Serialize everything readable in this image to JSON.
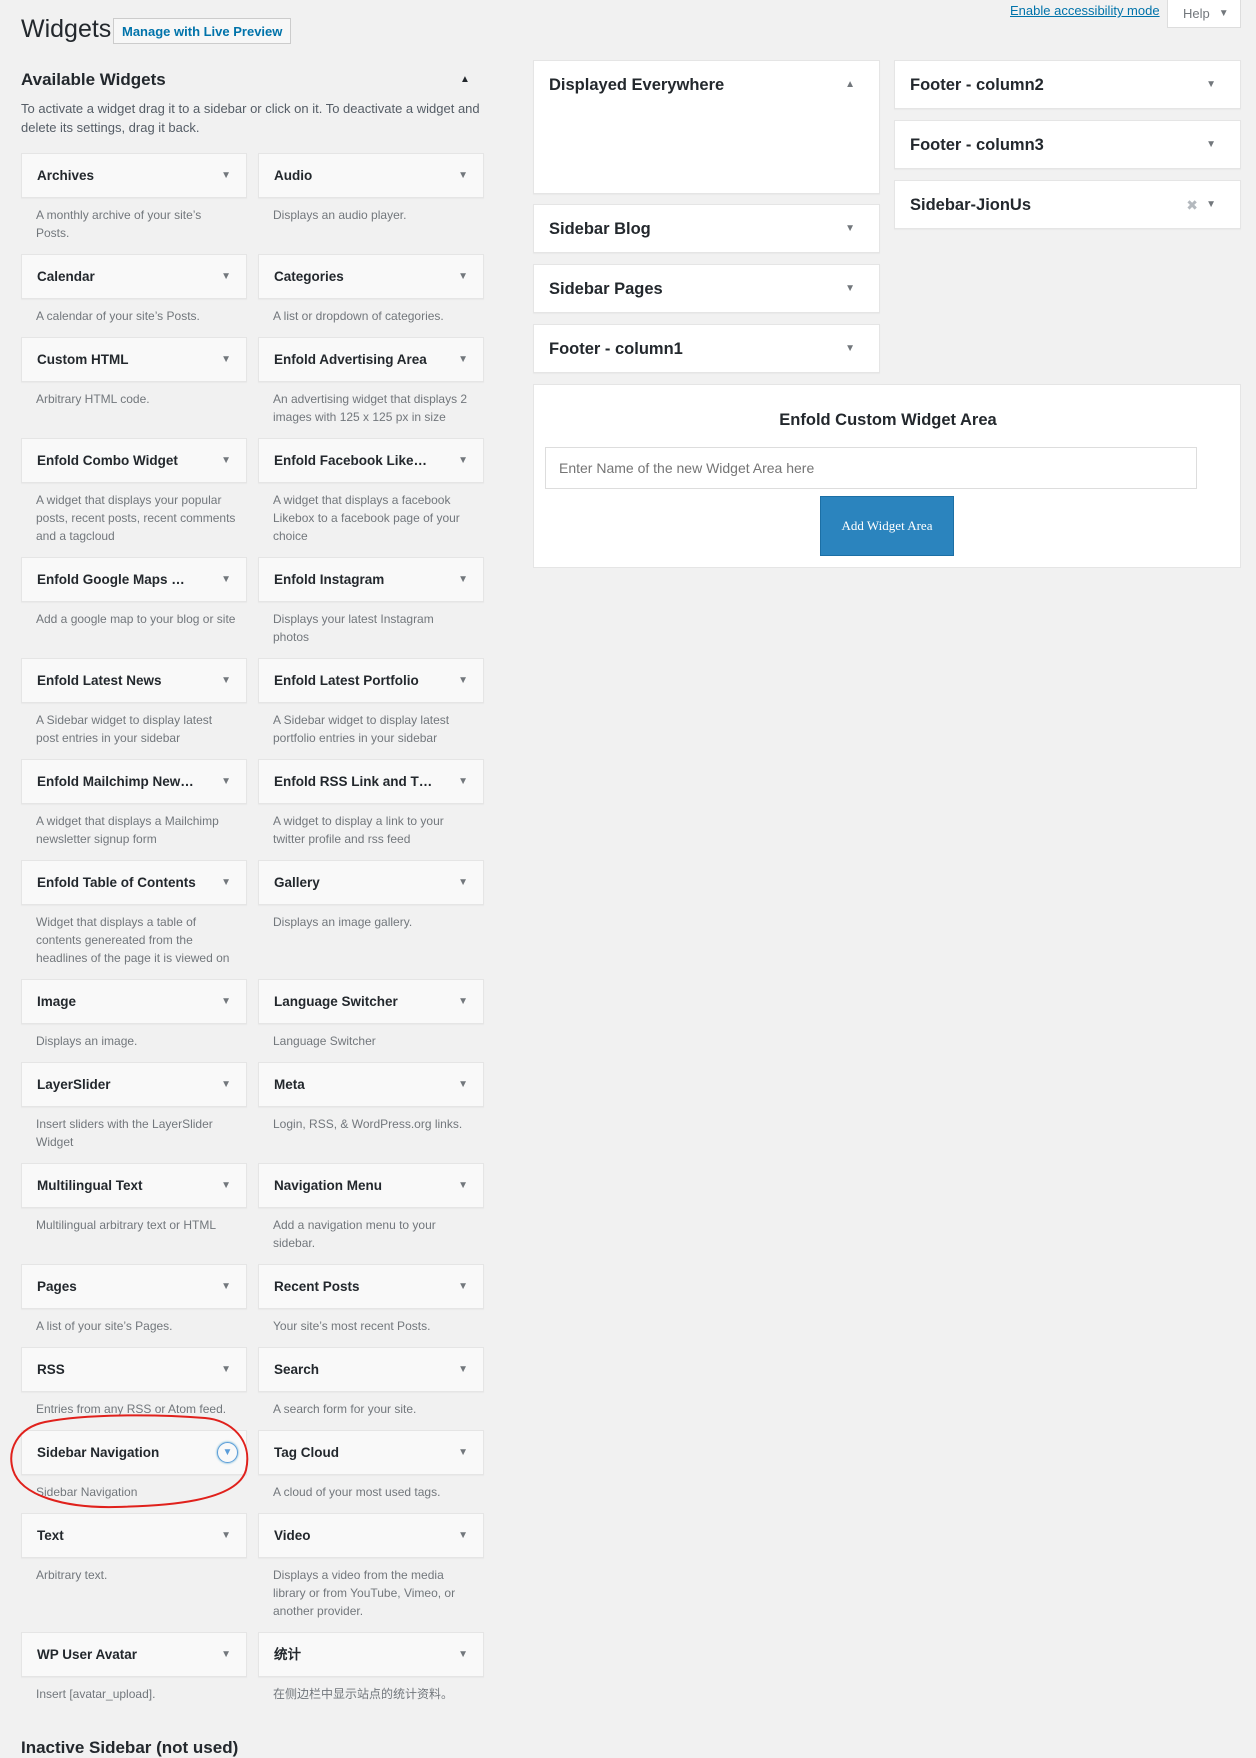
{
  "header": {
    "title": "Widgets",
    "live_preview_label": "Manage with Live Preview",
    "accessibility_link": "Enable accessibility mode",
    "help_label": "Help"
  },
  "available": {
    "title": "Available Widgets",
    "description": "To activate a widget drag it to a sidebar or click on it. To deactivate a widget and delete its settings, drag it back.",
    "widgets": [
      {
        "title": "Archives",
        "desc": "A monthly archive of your site’s Posts."
      },
      {
        "title": "Audio",
        "desc": "Displays an audio player."
      },
      {
        "title": "Calendar",
        "desc": "A calendar of your site’s Posts."
      },
      {
        "title": "Categories",
        "desc": "A list or dropdown of categories."
      },
      {
        "title": "Custom HTML",
        "desc": "Arbitrary HTML code."
      },
      {
        "title": "Enfold Advertising Area",
        "desc": "An advertising widget that displays 2 images with 125 x 125 px in size"
      },
      {
        "title": "Enfold Combo Widget",
        "desc": "A widget that displays your popular posts, recent posts, recent comments and a tagcloud"
      },
      {
        "title": "Enfold Facebook Like…",
        "desc": "A widget that displays a facebook Likebox to a facebook page of your choice"
      },
      {
        "title": "Enfold Google Maps …",
        "desc": "Add a google map to your blog or site"
      },
      {
        "title": "Enfold Instagram",
        "desc": "Displays your latest Instagram photos"
      },
      {
        "title": "Enfold Latest News",
        "desc": "A Sidebar widget to display latest post entries in your sidebar"
      },
      {
        "title": "Enfold Latest Portfolio",
        "desc": "A Sidebar widget to display latest portfolio entries in your sidebar"
      },
      {
        "title": "Enfold Mailchimp New…",
        "desc": "A widget that displays a Mailchimp newsletter signup form"
      },
      {
        "title": "Enfold RSS Link and T…",
        "desc": "A widget to display a link to your twitter profile and rss feed"
      },
      {
        "title": "Enfold Table of Contents",
        "desc": "Widget that displays a table of contents genereated from the headlines of the page it is viewed on"
      },
      {
        "title": "Gallery",
        "desc": "Displays an image gallery."
      },
      {
        "title": "Image",
        "desc": "Displays an image."
      },
      {
        "title": "Language Switcher",
        "desc": "Language Switcher"
      },
      {
        "title": "LayerSlider",
        "desc": "Insert sliders with the LayerSlider Widget"
      },
      {
        "title": "Meta",
        "desc": "Login, RSS, & WordPress.org links."
      },
      {
        "title": "Multilingual Text",
        "desc": "Multilingual arbitrary text or HTML"
      },
      {
        "title": "Navigation Menu",
        "desc": "Add a navigation menu to your sidebar."
      },
      {
        "title": "Pages",
        "desc": "A list of your site’s Pages."
      },
      {
        "title": "Recent Posts",
        "desc": "Your site’s most recent Posts."
      },
      {
        "title": "RSS",
        "desc": "Entries from any RSS or Atom feed."
      },
      {
        "title": "Search",
        "desc": "A search form for your site."
      },
      {
        "title": "Sidebar Navigation",
        "desc": "Sidebar Navigation"
      },
      {
        "title": "Tag Cloud",
        "desc": "A cloud of your most used tags."
      },
      {
        "title": "Text",
        "desc": "Arbitrary text."
      },
      {
        "title": "Video",
        "desc": "Displays a video from the media library or from YouTube, Vimeo, or another provider."
      },
      {
        "title": "WP User Avatar",
        "desc": "Insert [avatar_upload]."
      },
      {
        "title": "统计",
        "desc": "在侧边栏中显示站点的统计资料。"
      }
    ]
  },
  "sidebars": {
    "displayed_everywhere": "Displayed Everywhere",
    "sidebar_blog": "Sidebar Blog",
    "sidebar_pages": "Sidebar Pages",
    "footer_column1": "Footer - column1",
    "footer_column2": "Footer - column2",
    "footer_column3": "Footer - column3",
    "sidebar_jionus": "Sidebar-JionUs"
  },
  "custom_area": {
    "title": "Enfold Custom Widget Area",
    "input_placeholder": "Enter Name of the new Widget Area here",
    "add_button": "Add Widget Area"
  },
  "inactive": {
    "title": "Inactive Sidebar (not used)"
  },
  "icons": {
    "collapse": "triangle-up-icon",
    "expand": "triangle-down-icon",
    "delete": "x-icon"
  },
  "colors": {
    "link": "#0073aa",
    "button": "#2b84be",
    "highlight": "#e0211c"
  }
}
